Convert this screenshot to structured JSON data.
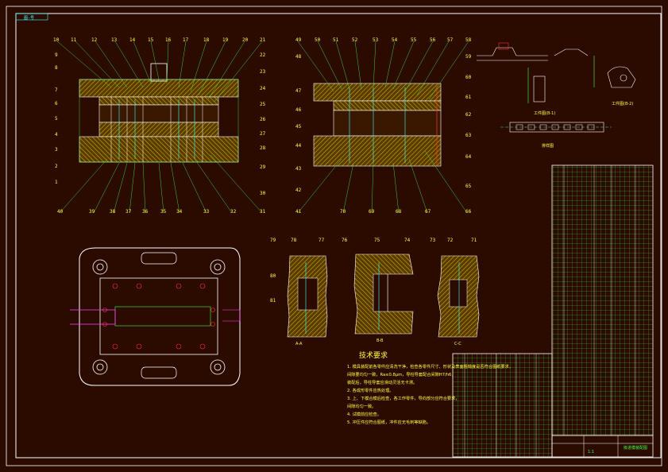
{
  "drawing": {
    "corner_tag": "图-号"
  },
  "callouts_left": [
    "10",
    "11",
    "12",
    "13",
    "14",
    "15",
    "16",
    "17",
    "18",
    "19",
    "20",
    "21",
    "9",
    "8",
    "7",
    "6",
    "5",
    "4",
    "3",
    "2",
    "1",
    "22",
    "23",
    "24",
    "25",
    "26",
    "27",
    "28",
    "29",
    "30",
    "31",
    "32",
    "33",
    "34",
    "35",
    "36",
    "37",
    "38",
    "39",
    "40"
  ],
  "callouts_right": [
    "49",
    "50",
    "51",
    "52",
    "53",
    "54",
    "55",
    "56",
    "57",
    "58",
    "48",
    "47",
    "46",
    "45",
    "44",
    "43",
    "42",
    "41",
    "59",
    "60",
    "61",
    "62",
    "63",
    "64",
    "65",
    "66",
    "67",
    "68",
    "69",
    "70"
  ],
  "callouts_detail": [
    "79",
    "78",
    "77",
    "76",
    "75",
    "74",
    "73",
    "72",
    "71",
    "80",
    "81"
  ],
  "section_labels": {
    "detail_a": "A-A",
    "detail_b": "B-B",
    "detail_c": "C-C",
    "part_view": "工件图(B-1)",
    "part_view2": "工件图(B-2)",
    "strip": "排样图"
  },
  "tech_requirements": {
    "title": "技术要求",
    "items": [
      "1. 模具装配前各零件应清洗干净，检查各零件尺寸、形状及表面粗糙度是否符合图纸要求，",
      "   间隙要均匀一致，Ra≤0.8μm，导柱导套配合间隙H7/h6，",
      "   装配后，导柱导套应滑动灵活无卡滞。",
      "2. 各成形零件应热处理。",
      "3. 上、下模合模后检查，各工作零件，导向部分应符合要求，",
      "   间隙均匀一致。",
      "4. 试模前应检查。",
      "5. 冲压件应符合图纸，冲件应无毛刺等缺陷。"
    ]
  },
  "title_block": {
    "name": "级进模装配图",
    "scale": "1:1"
  },
  "colors": {
    "background": "#2b0a00",
    "border": "#ffffff",
    "outline": "#ffffff",
    "hatch": "#ffff40",
    "callout": "#40ff40",
    "cyan": "#40ffff",
    "magenta": "#ff40ff",
    "red": "#ff3030",
    "text": "#ffff40"
  }
}
